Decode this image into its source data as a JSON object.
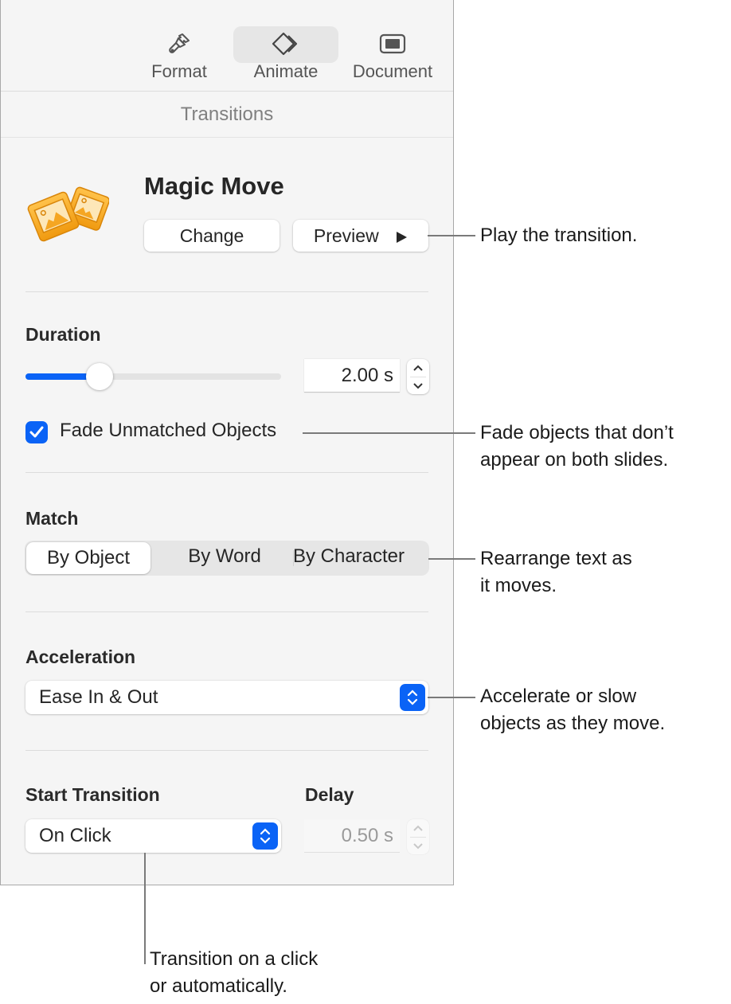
{
  "toolbar": {
    "tabs": [
      {
        "label": "Format",
        "icon": "paintbrush-icon",
        "active": false
      },
      {
        "label": "Animate",
        "icon": "animate-diamonds-icon",
        "active": true
      },
      {
        "label": "Document",
        "icon": "document-icon",
        "active": false
      }
    ]
  },
  "section_title": "Transitions",
  "transition": {
    "name": "Magic Move",
    "icon": "magic-move-photos-icon",
    "change_label": "Change",
    "preview_label": "Preview",
    "preview_icon": "play-icon"
  },
  "duration": {
    "label": "Duration",
    "slider_fraction": 0.29,
    "value": "2.00 s"
  },
  "fade_unmatched": {
    "label": "Fade Unmatched Objects",
    "checked": true
  },
  "match": {
    "label": "Match",
    "options": [
      "By Object",
      "By Word",
      "By Character"
    ],
    "selected": "By Object"
  },
  "acceleration": {
    "label": "Acceleration",
    "value": "Ease In & Out"
  },
  "start_transition": {
    "label": "Start Transition",
    "value": "On Click"
  },
  "delay": {
    "label": "Delay",
    "value": "0.50 s",
    "disabled": true
  },
  "callouts": {
    "preview": "Play the transition.",
    "fade_line1": "Fade objects that don’t",
    "fade_line2": "appear on both slides.",
    "match_line1": "Rearrange text as",
    "match_line2": "it moves.",
    "accel_line1": "Accelerate or slow",
    "accel_line2": "objects as they move.",
    "start_line1": "Transition on a click",
    "start_line2": "or automatically."
  },
  "colors": {
    "accent": "#0a63f6",
    "icon_orange": "#f5a623"
  }
}
